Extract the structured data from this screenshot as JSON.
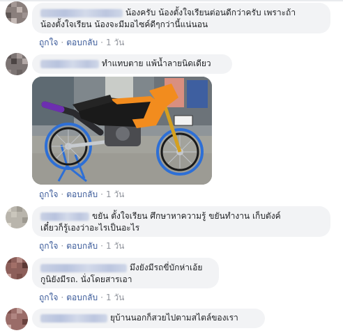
{
  "comments": [
    {
      "text_line1": "น้องครับ น้องตั้งใจเรียนต่อนดีกว่าครับ เพราะถ้า",
      "text_line2": "น้องตั้งใจเรียน น้องจะมีมอไซค์ดีๆกว่านี้แน่นอน",
      "like": "ถูกใจ",
      "reply": "ตอบกลับ",
      "time": "1 วัน"
    },
    {
      "text": "ทำแทบตาย แพ้น้ำลายนิดเดียว",
      "like": "ถูกใจ",
      "reply": "ตอบกลับ",
      "time": "1 วัน"
    },
    {
      "text_line1": "ขยัน ตั้งใจเรียน ศึกษาหาความรู้ ขยันทำงาน เก็บตังค์",
      "text_line2": "เดี๋ยวก็รู้เองว่าอะไรเป็นอะไร",
      "like": "ถูกใจ",
      "reply": "ตอบกลับ",
      "time": "1 วัน"
    },
    {
      "text_line1": "มึงยังมีรถขี่บักห่าเอ้ย",
      "text_line2": "กูนิยังมีรถ. นั่งโดยสารเอา",
      "like": "ถูกใจ",
      "reply": "ตอบกลับ",
      "time": "1 วัน"
    },
    {
      "text": "ยุบ้านนอกก็สวยไปตามสไตล์ของเรา"
    }
  ],
  "photo": {
    "description_icon": "motorcycle-photo",
    "colors": {
      "orange": "#f28c1e",
      "black": "#1a1a1a",
      "blue": "#2d6fd6"
    }
  }
}
